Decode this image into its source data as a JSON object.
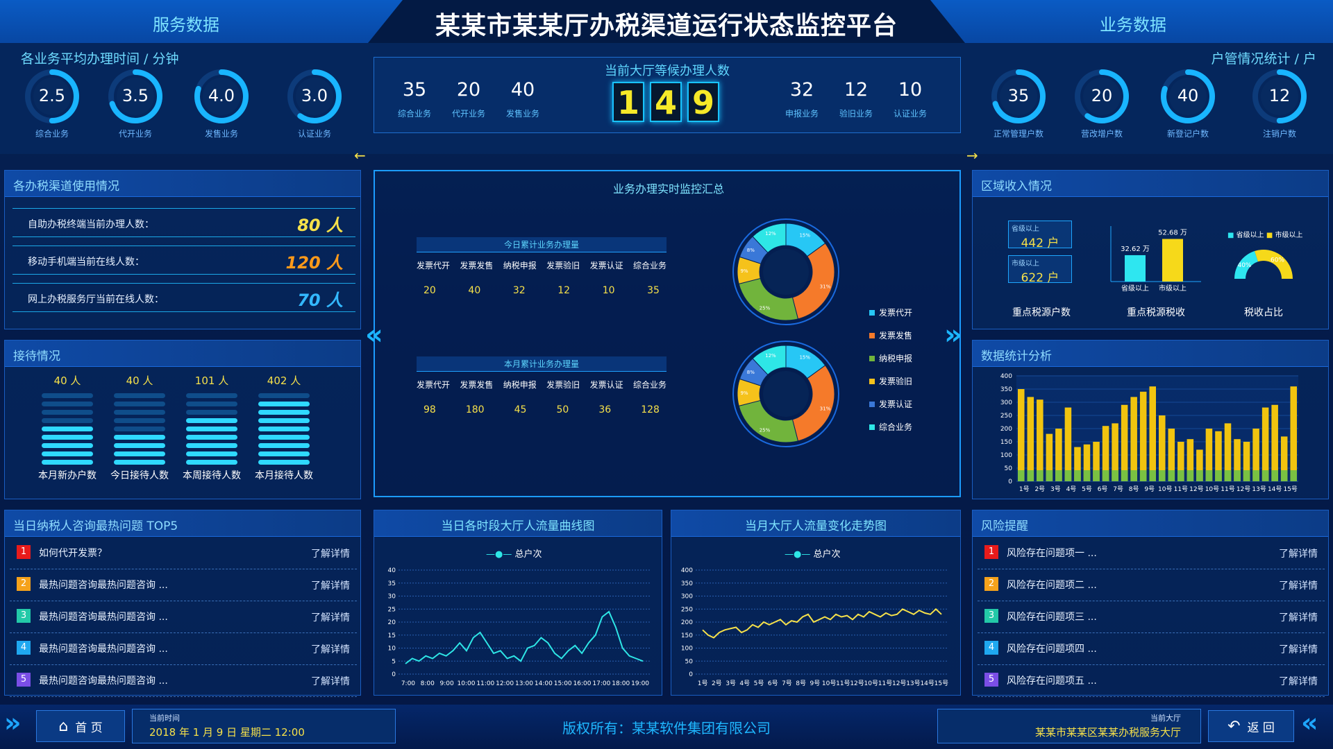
{
  "header": {
    "title": "某某市某某厅办税渠道运行状态监控平台",
    "left_title": "服务数据",
    "right_title": "业务数据"
  },
  "avg_time": {
    "title": "各业务平均办理时间 / 分钟",
    "gauges": [
      {
        "value": "2.5",
        "label": "综合业务",
        "level": 0.5
      },
      {
        "value": "3.5",
        "label": "代开业务",
        "level": 0.7
      },
      {
        "value": "4.0",
        "label": "发售业务",
        "level": 0.8
      },
      {
        "value": "3.0",
        "label": "认证业务",
        "level": 0.6
      }
    ]
  },
  "household": {
    "title": "户管情况统计 / 户",
    "gauges": [
      {
        "value": "35",
        "label": "正常管理户数",
        "level": 0.7
      },
      {
        "value": "20",
        "label": "营改增户数",
        "level": 0.6
      },
      {
        "value": "40",
        "label": "新登记户数",
        "level": 0.8
      },
      {
        "value": "12",
        "label": "注销户数",
        "level": 0.5
      }
    ]
  },
  "waiting": {
    "title": "当前大厅等候办理人数",
    "digits": [
      "1",
      "4",
      "9"
    ],
    "left_stats": [
      {
        "value": "35",
        "label": "综合业务"
      },
      {
        "value": "20",
        "label": "代开业务"
      },
      {
        "value": "40",
        "label": "发售业务"
      }
    ],
    "right_stats": [
      {
        "value": "32",
        "label": "申报业务"
      },
      {
        "value": "12",
        "label": "验旧业务"
      },
      {
        "value": "10",
        "label": "认证业务"
      }
    ]
  },
  "channels": {
    "title": "各办税渠道使用情况",
    "rows": [
      {
        "label": "自助办税终端当前办理人数：",
        "value": "80 人",
        "color": "#f6e14a"
      },
      {
        "label": "移动手机端当前在线人数：",
        "value": "120 人",
        "color": "#ff9a1a"
      },
      {
        "label": "网上办税服务厅当前在线人数：",
        "value": "70 人",
        "color": "#33b8ff"
      }
    ]
  },
  "reception": {
    "title": "接待情况",
    "items": [
      {
        "top": "40 人",
        "label": "本月新办户数",
        "level": 0.5
      },
      {
        "top": "40 人",
        "label": "今日接待人数",
        "level": 0.4
      },
      {
        "top": "101 人",
        "label": "本周接待人数",
        "level": 0.7
      },
      {
        "top": "402 人",
        "label": "本月接待人数",
        "level": 0.9
      }
    ]
  },
  "top5": {
    "title": "当日纳税人咨询最热问题 TOP5",
    "link_label": "了解详情",
    "items": [
      {
        "num": "1",
        "text": "如何代开发票？",
        "color": "#e81b1b"
      },
      {
        "num": "2",
        "text": "最热问题咨询最热问题咨询 ...",
        "color": "#f5a21b"
      },
      {
        "num": "3",
        "text": "最热问题咨询最热问题咨询 ...",
        "color": "#23c9a8"
      },
      {
        "num": "4",
        "text": "最热问题咨询最热问题咨询 ...",
        "color": "#1fa8f0"
      },
      {
        "num": "5",
        "text": "最热问题咨询最热问题咨询 ...",
        "color": "#7a4ee6"
      }
    ]
  },
  "monitor": {
    "title": "业务办理实时监控汇总",
    "columns": [
      "发票代开",
      "发票发售",
      "纳税申报",
      "发票验旧",
      "发票认证",
      "综合业务"
    ],
    "today": {
      "title": "今日累计业务办理量",
      "values": [
        "20",
        "40",
        "32",
        "12",
        "10",
        "35"
      ]
    },
    "month": {
      "title": "本月累计业务办理量",
      "values": [
        "98",
        "180",
        "45",
        "50",
        "36",
        "128"
      ]
    },
    "legend": [
      {
        "label": "发票代开",
        "color": "#27c7f5"
      },
      {
        "label": "发票发售",
        "color": "#f57a2a"
      },
      {
        "label": "纳税申报",
        "color": "#71b43c"
      },
      {
        "label": "发票验旧",
        "color": "#f5c21b"
      },
      {
        "label": "发票认证",
        "color": "#3a78d8"
      },
      {
        "label": "综合业务",
        "color": "#2ee6e6"
      }
    ],
    "donut_segments": [
      {
        "pct": 15,
        "label": "15%",
        "color": "#27c7f5"
      },
      {
        "pct": 31,
        "label": "31%",
        "color": "#f57a2a"
      },
      {
        "pct": 25,
        "label": "25%",
        "color": "#71b43c"
      },
      {
        "pct": 9,
        "label": "9%",
        "color": "#f5c21b"
      },
      {
        "pct": 8,
        "label": "8%",
        "color": "#3a78d8"
      },
      {
        "pct": 12,
        "label": "12%",
        "color": "#2ee6e6"
      }
    ]
  },
  "region": {
    "title": "区域收入情况",
    "boxes": [
      {
        "small": "省级以上",
        "value": "442 户"
      },
      {
        "small": "市级以上",
        "value": "622 户"
      }
    ],
    "box_caption": "重点税源户数",
    "bars": [
      {
        "top": "32.62 万",
        "value": 32.62,
        "label": "省级以上",
        "color": "#2ee6f0"
      },
      {
        "top": "52.68 万",
        "value": 52.68,
        "label": "市级以上",
        "color": "#f6d91a"
      }
    ],
    "bar_caption": "重点税源税收",
    "ratio_legend": [
      "省级以上",
      "市级以上"
    ],
    "ratio": [
      {
        "label": "40%",
        "value": 40,
        "color": "#2ee6f0"
      },
      {
        "label": "60%",
        "value": 60,
        "color": "#f6d91a"
      }
    ],
    "ratio_caption": "税收占比"
  },
  "stats": {
    "title": "数据统计分析",
    "chart_data": {
      "type": "bar",
      "categories": [
        "1号",
        "2号",
        "3号",
        "4号",
        "5号",
        "6号",
        "7号",
        "8号",
        "9号",
        "10号",
        "11号",
        "12号",
        "10号",
        "11号",
        "12号",
        "13号",
        "14号",
        "15号"
      ],
      "ylim": [
        0,
        400
      ],
      "yticks": [
        "0",
        "50",
        "100",
        "150",
        "200",
        "250",
        "300",
        "350",
        "400"
      ],
      "series": [
        {
          "values": [
            350,
            320,
            310,
            180,
            200,
            280,
            130,
            140,
            150,
            210,
            220,
            290,
            320,
            340,
            360,
            250,
            200,
            150,
            160,
            120,
            200,
            190,
            220,
            160,
            150,
            200,
            280,
            290,
            170,
            360
          ]
        }
      ]
    }
  },
  "hourly": {
    "title": "当日各时段大厅人流量曲线图",
    "legend": "总户次",
    "chart_data": {
      "type": "line",
      "x": [
        "7:00",
        "8:00",
        "9:00",
        "10:00",
        "11:00",
        "12:00",
        "13:00",
        "14:00",
        "15:00",
        "16:00",
        "17:00",
        "18:00",
        "19:00"
      ],
      "ylim": [
        0,
        40
      ],
      "yticks": [
        "0",
        "5",
        "10",
        "15",
        "20",
        "25",
        "30",
        "35",
        "40"
      ],
      "series": [
        {
          "name": "总户次",
          "values": [
            4,
            6,
            5,
            7,
            6,
            8,
            7,
            9,
            12,
            9,
            14,
            16,
            12,
            8,
            9,
            6,
            7,
            5,
            10,
            11,
            14,
            12,
            8,
            6,
            9,
            11,
            8,
            12,
            15,
            22,
            24,
            18,
            10,
            7,
            6,
            5
          ]
        }
      ]
    }
  },
  "monthly": {
    "title": "当月大厅人流量变化走势图",
    "legend": "总户次",
    "chart_data": {
      "type": "line",
      "x": [
        "1号",
        "2号",
        "3号",
        "4号",
        "5号",
        "6号",
        "7号",
        "8号",
        "9号",
        "10号",
        "11号",
        "12号",
        "10号",
        "11号",
        "12号",
        "13号",
        "14号",
        "15号"
      ],
      "ylim": [
        0,
        400
      ],
      "yticks": [
        "0",
        "50",
        "100",
        "150",
        "200",
        "250",
        "300",
        "350",
        "400"
      ],
      "series": [
        {
          "name": "总户次",
          "values": [
            170,
            150,
            140,
            160,
            170,
            175,
            180,
            160,
            170,
            190,
            180,
            200,
            190,
            200,
            210,
            190,
            205,
            200,
            220,
            230,
            200,
            210,
            220,
            210,
            230,
            220,
            225,
            210,
            230,
            220,
            240,
            230,
            220,
            235,
            225,
            230,
            250,
            240,
            230,
            245,
            235,
            230,
            250,
            230
          ]
        }
      ]
    }
  },
  "risk": {
    "title": "风险提醒",
    "link_label": "了解详情",
    "items": [
      {
        "num": "1",
        "text": "风险存在问题项一 ...",
        "color": "#e81b1b"
      },
      {
        "num": "2",
        "text": "风险存在问题项二 ...",
        "color": "#f5a21b"
      },
      {
        "num": "3",
        "text": "风险存在问题项三 ...",
        "color": "#23c9a8"
      },
      {
        "num": "4",
        "text": "风险存在问题项四 ...",
        "color": "#1fa8f0"
      },
      {
        "num": "5",
        "text": "风险存在问题项五 ...",
        "color": "#7a4ee6"
      }
    ]
  },
  "footer": {
    "home_label": "首 页",
    "time_caption": "当前时间",
    "time_value": "2018 年 1 月 9 日   星期二   12:00",
    "copyright": "版权所有：某某软件集团有限公司",
    "hall_caption": "当前大厅",
    "hall_value": "某某市某某区某某办税服务大厅",
    "back_label": "返 回"
  }
}
